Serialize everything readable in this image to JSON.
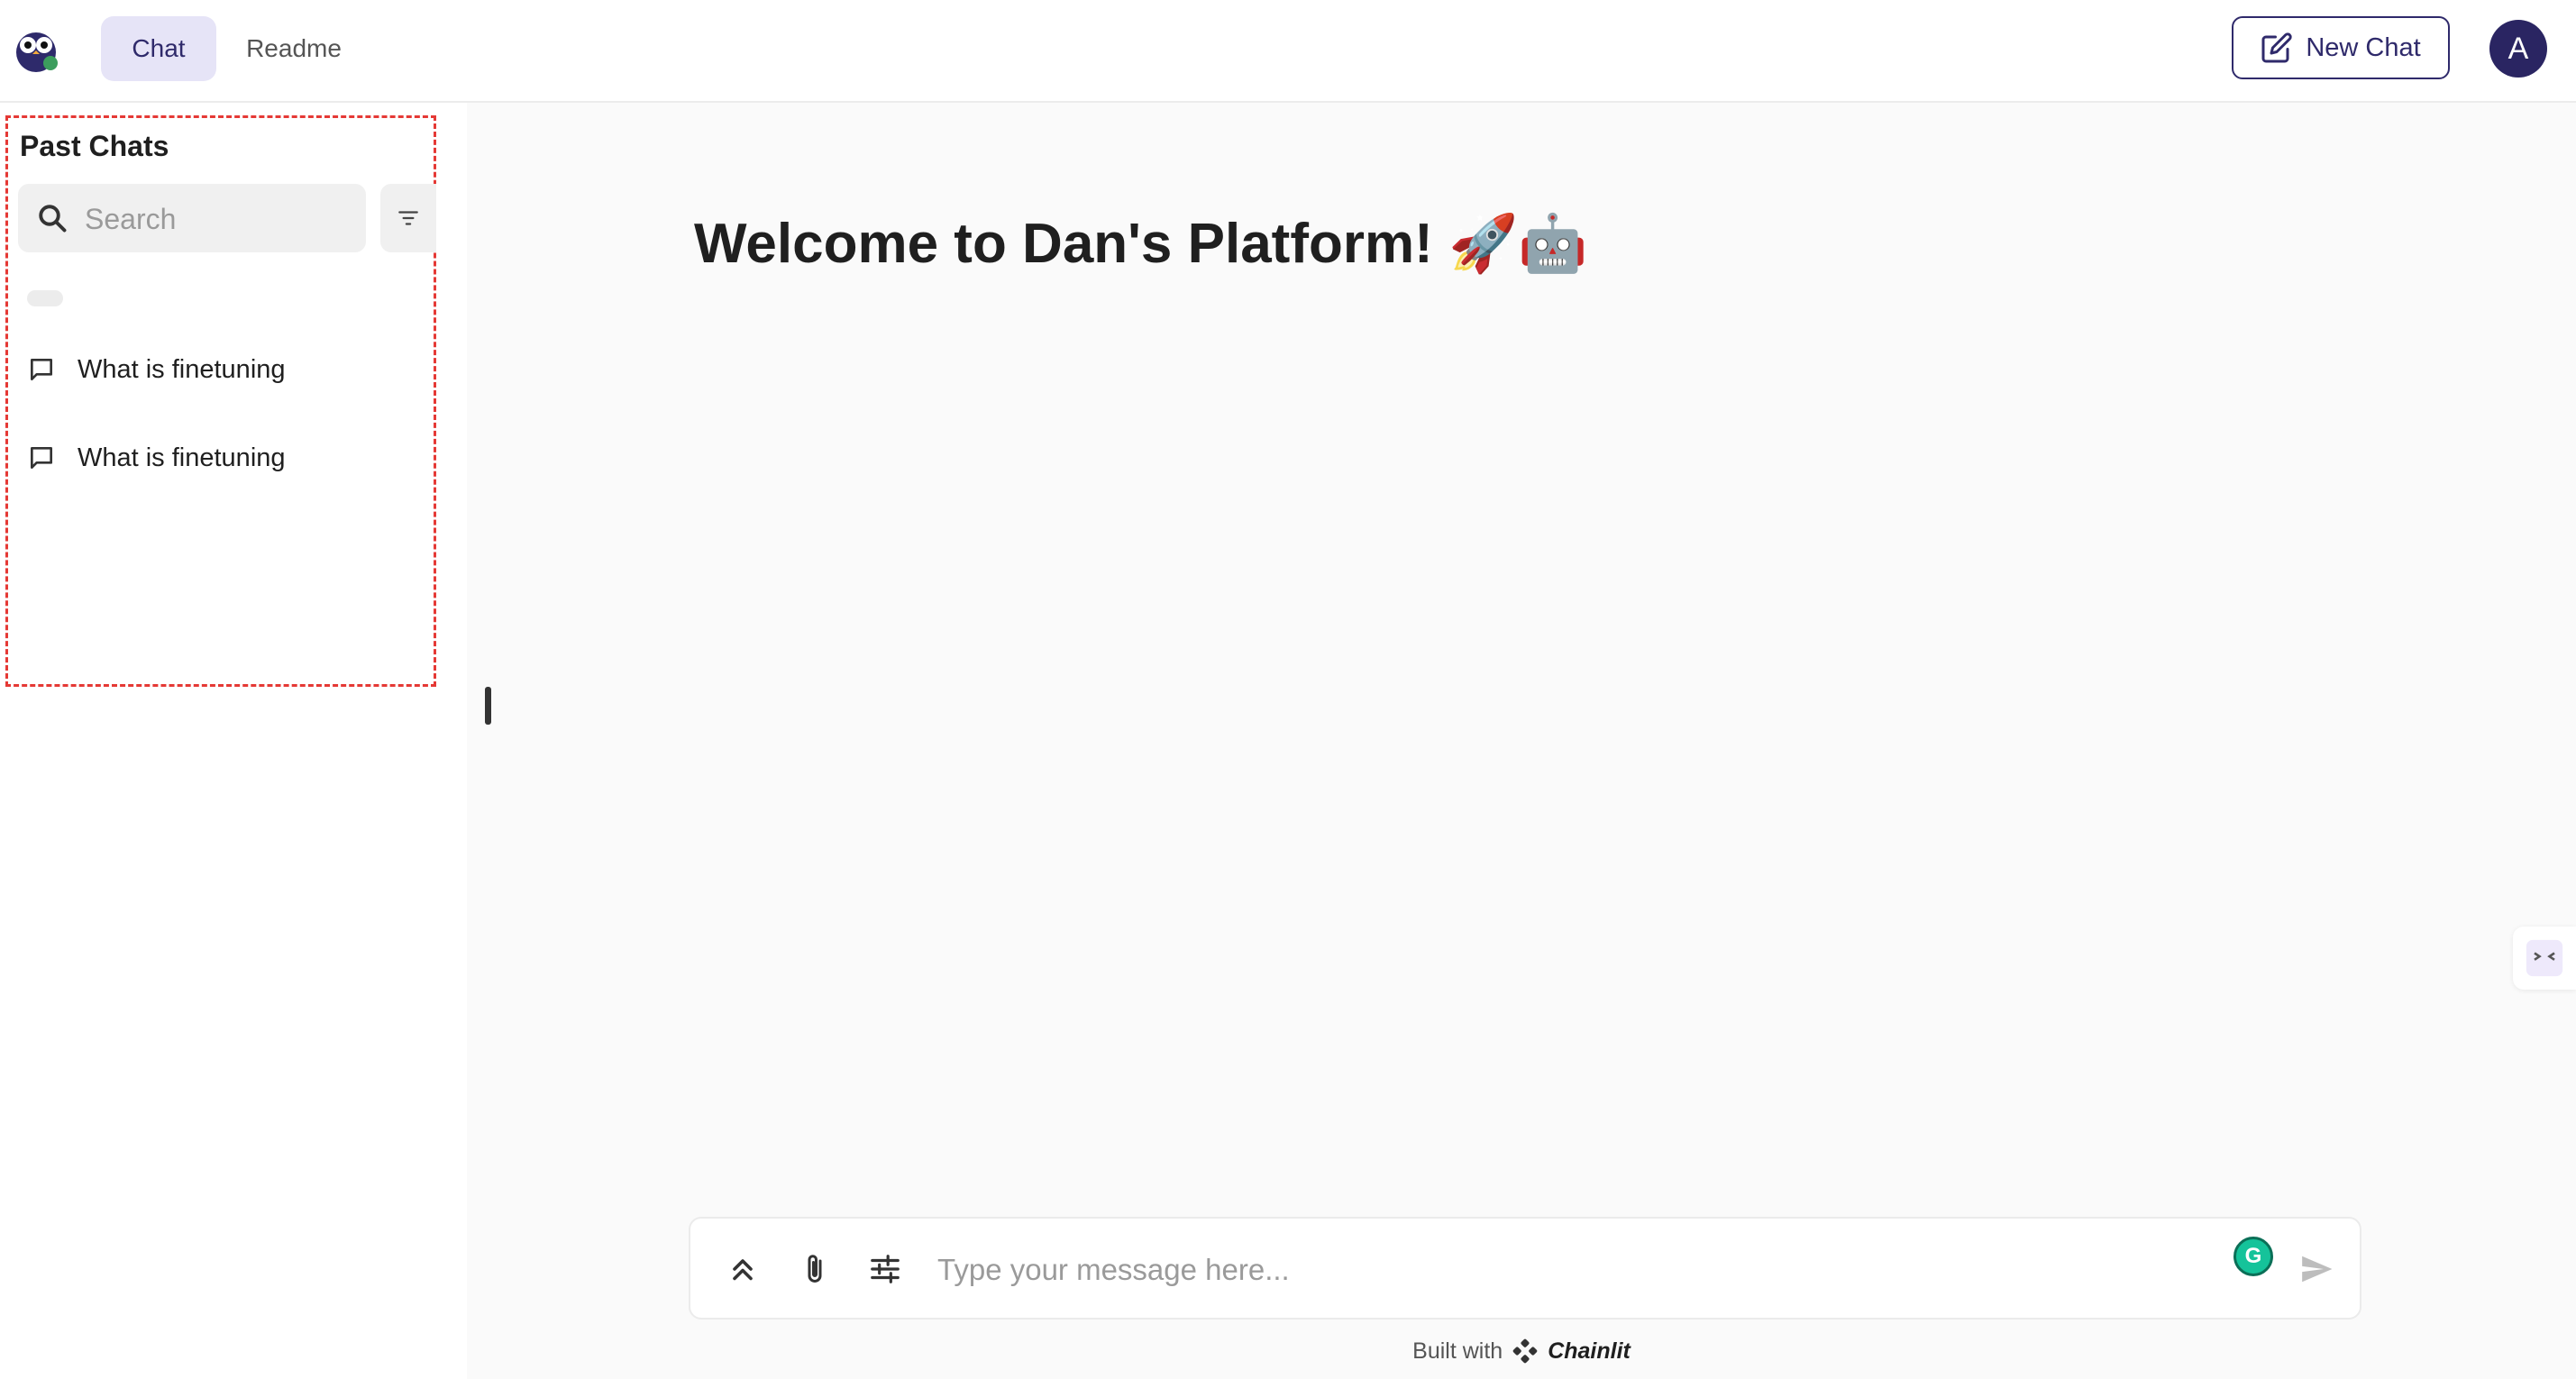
{
  "header": {
    "tabs": [
      {
        "label": "Chat",
        "active": true
      },
      {
        "label": "Readme",
        "active": false
      }
    ],
    "new_chat_label": "New Chat",
    "avatar_initial": "A"
  },
  "sidebar": {
    "title": "Past Chats",
    "search_placeholder": "Search",
    "chats": [
      {
        "label": "What is finetuning",
        "icon": "chat-bubble-icon"
      },
      {
        "label": "What is finetuning",
        "icon": "chat-bubble-icon"
      }
    ]
  },
  "main": {
    "welcome": "Welcome to Dan's Platform! 🚀🤖"
  },
  "composer": {
    "placeholder": "Type your message here...",
    "icons": [
      "collapse-up-icon",
      "paperclip-icon",
      "settings-sliders-icon",
      "grammarly-icon",
      "send-icon"
    ]
  },
  "footer": {
    "built_with": "Built with",
    "brand": "Chainlit"
  },
  "colors": {
    "accent": "#2f2a6b",
    "active_tab_bg": "#e6e4f7",
    "dashed_border": "#e53935",
    "main_bg": "#fafafa"
  }
}
